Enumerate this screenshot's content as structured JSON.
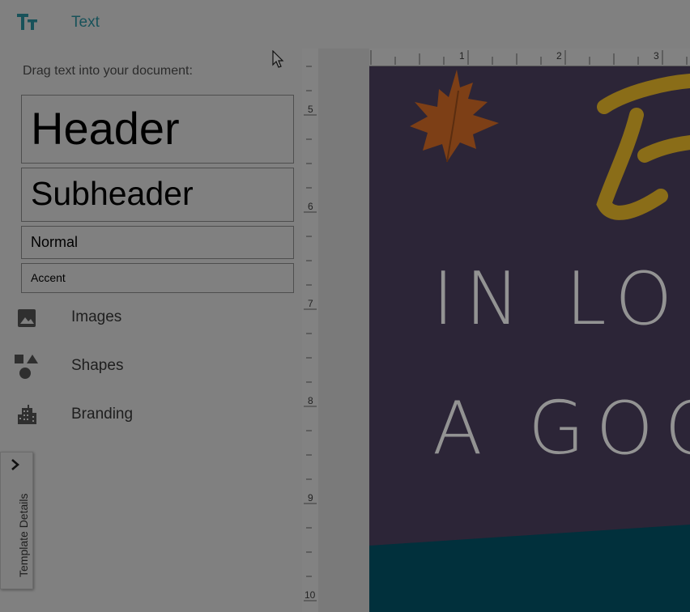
{
  "topbar": {
    "icon": "text-tt-icon",
    "title": "Text"
  },
  "sidebar": {
    "hint": "Drag text into your document:",
    "text_styles": [
      {
        "name": "header",
        "label": "Header"
      },
      {
        "name": "subheader",
        "label": "Subheader"
      },
      {
        "name": "normal",
        "label": "Normal"
      },
      {
        "name": "accent",
        "label": "Accent"
      }
    ],
    "nav": [
      {
        "icon": "image-icon",
        "label": "Images"
      },
      {
        "icon": "shapes-icon",
        "label": "Shapes"
      },
      {
        "icon": "building-icon",
        "label": "Branding"
      }
    ]
  },
  "details_tab": {
    "label": "Template Details",
    "icon": "chevron-right-icon"
  },
  "canvas": {
    "ruler_top_labels": [
      "1",
      "2",
      "3"
    ],
    "ruler_left_labels": [
      "5",
      "6",
      "7",
      "8",
      "9",
      "10"
    ],
    "document_lines": [
      "IN LO",
      "A GOO"
    ],
    "colors": {
      "page_bg": "#2c2537",
      "leaf": "#7d3f16",
      "script_stroke": "#8a6d18",
      "teal_band": "#01303c",
      "text": "#939393"
    }
  },
  "colors": {
    "accent": "#18525a",
    "overlay": "#808080"
  }
}
